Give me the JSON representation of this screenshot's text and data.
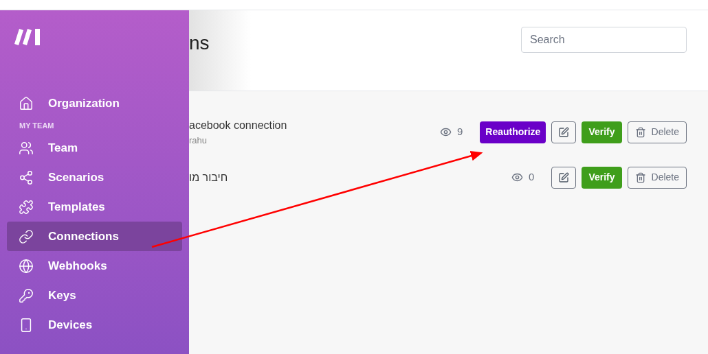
{
  "sidebar": {
    "items": [
      {
        "kind": "link",
        "label": "Organization",
        "selected": false
      },
      {
        "kind": "heading",
        "label": "MY TEAM"
      },
      {
        "kind": "link",
        "label": "Team",
        "selected": false
      },
      {
        "kind": "link",
        "label": "Scenarios",
        "selected": false
      },
      {
        "kind": "link",
        "label": "Templates",
        "selected": false
      },
      {
        "kind": "link",
        "label": "Connections",
        "selected": true
      },
      {
        "kind": "link",
        "label": "Webhooks",
        "selected": false
      },
      {
        "kind": "link",
        "label": "Keys",
        "selected": false
      },
      {
        "kind": "link",
        "label": "Devices",
        "selected": false
      }
    ]
  },
  "header": {
    "title": "ns",
    "search": {
      "placeholder": "Search"
    }
  },
  "connections": [
    {
      "name": "acebook connection",
      "owner": "rahu",
      "views": "9",
      "actions": [
        {
          "kind": "reauthorize",
          "label": "Reauthorize"
        },
        {
          "kind": "edit"
        },
        {
          "kind": "verify",
          "label": "Verify"
        },
        {
          "kind": "delete",
          "label": "Delete"
        }
      ]
    },
    {
      "name": "חיבור מו",
      "views": "0",
      "actions": [
        {
          "kind": "edit"
        },
        {
          "kind": "verify",
          "label": "Verify"
        },
        {
          "kind": "delete",
          "label": "Delete"
        }
      ]
    }
  ]
}
